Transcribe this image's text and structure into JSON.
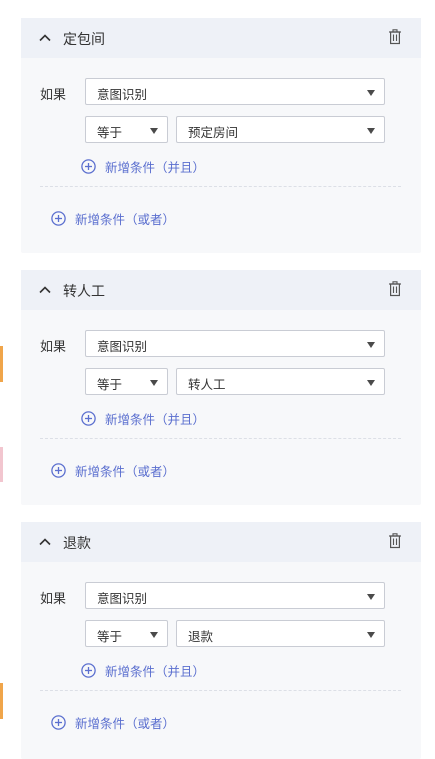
{
  "rules": [
    {
      "title": "定包间",
      "if_label": "如果",
      "field_value": "意图识别",
      "operator_value": "等于",
      "target_value": "预定房间",
      "add_and_label": "新增条件（并且）",
      "add_or_label": "新增条件（或者）"
    },
    {
      "title": "转人工",
      "if_label": "如果",
      "field_value": "意图识别",
      "operator_value": "等于",
      "target_value": "转人工",
      "add_and_label": "新增条件（并且）",
      "add_or_label": "新增条件（或者）"
    },
    {
      "title": "退款",
      "if_label": "如果",
      "field_value": "意图识别",
      "operator_value": "等于",
      "target_value": "退款",
      "add_and_label": "新增条件（并且）",
      "add_or_label": "新增条件（或者）"
    }
  ],
  "icons": {
    "collapse": "chevron-up-icon",
    "delete": "trash-icon",
    "add": "plus-circle-icon",
    "dropdown": "caret-down-icon"
  },
  "colors": {
    "accent": "#5b6fcf",
    "panel_bg": "#f7f8fa",
    "header_bg": "#eef1f7"
  }
}
